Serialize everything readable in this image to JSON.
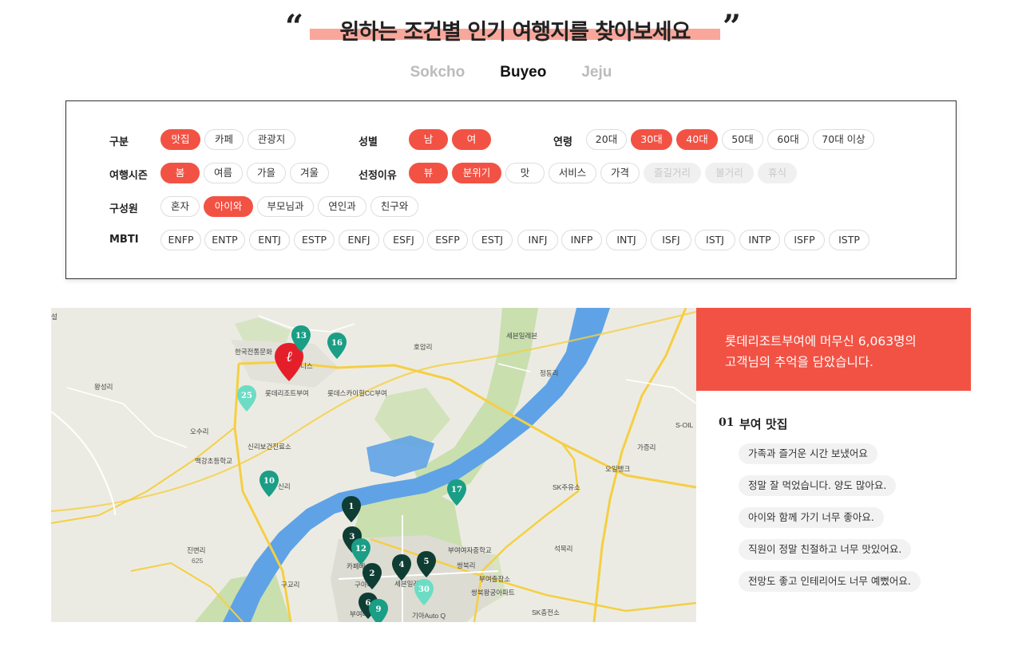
{
  "headline": {
    "quote_open": "“",
    "quote_close": "”",
    "text": "원하는 조건별 인기 여행지를 찾아보세요"
  },
  "regions": [
    {
      "label": "Sokcho",
      "active": false
    },
    {
      "label": "Buyeo",
      "active": true
    },
    {
      "label": "Jeju",
      "active": false
    }
  ],
  "filters": {
    "category": {
      "label": "구분",
      "options": [
        {
          "text": "맛집",
          "state": "selected"
        },
        {
          "text": "카페",
          "state": "normal"
        },
        {
          "text": "관광지",
          "state": "normal"
        }
      ]
    },
    "gender": {
      "label": "성별",
      "options": [
        {
          "text": "남",
          "state": "selected"
        },
        {
          "text": "여",
          "state": "selected"
        }
      ]
    },
    "age": {
      "label": "연령",
      "options": [
        {
          "text": "20대",
          "state": "normal"
        },
        {
          "text": "30대",
          "state": "selected"
        },
        {
          "text": "40대",
          "state": "selected"
        },
        {
          "text": "50대",
          "state": "normal"
        },
        {
          "text": "60대",
          "state": "normal"
        },
        {
          "text": "70대 이상",
          "state": "normal"
        }
      ]
    },
    "season": {
      "label": "여행시즌",
      "options": [
        {
          "text": "봄",
          "state": "selected"
        },
        {
          "text": "여름",
          "state": "normal"
        },
        {
          "text": "가을",
          "state": "normal"
        },
        {
          "text": "겨울",
          "state": "normal"
        }
      ]
    },
    "reason": {
      "label": "선정이유",
      "options": [
        {
          "text": "뷰",
          "state": "selected"
        },
        {
          "text": "분위기",
          "state": "selected"
        },
        {
          "text": "맛",
          "state": "normal"
        },
        {
          "text": "서비스",
          "state": "normal"
        },
        {
          "text": "가격",
          "state": "normal"
        },
        {
          "text": "즐길거리",
          "state": "disabled"
        },
        {
          "text": "볼거리",
          "state": "disabled"
        },
        {
          "text": "휴식",
          "state": "disabled"
        }
      ]
    },
    "companion": {
      "label": "구성원",
      "options": [
        {
          "text": "혼자",
          "state": "normal"
        },
        {
          "text": "아이와",
          "state": "selected"
        },
        {
          "text": "부모님과",
          "state": "normal"
        },
        {
          "text": "연인과",
          "state": "normal"
        },
        {
          "text": "친구와",
          "state": "normal"
        }
      ]
    },
    "mbti": {
      "label": "MBTI",
      "options": [
        {
          "text": "ENFP",
          "state": "normal"
        },
        {
          "text": "ENTP",
          "state": "normal"
        },
        {
          "text": "ENTJ",
          "state": "normal"
        },
        {
          "text": "ESTP",
          "state": "normal"
        },
        {
          "text": "ENFJ",
          "state": "normal"
        },
        {
          "text": "ESFJ",
          "state": "normal"
        },
        {
          "text": "ESFP",
          "state": "normal"
        },
        {
          "text": "ESTJ",
          "state": "normal"
        },
        {
          "text": "INFJ",
          "state": "normal"
        },
        {
          "text": "INFP",
          "state": "normal"
        },
        {
          "text": "INTJ",
          "state": "normal"
        },
        {
          "text": "ISFJ",
          "state": "normal"
        },
        {
          "text": "ISTJ",
          "state": "normal"
        },
        {
          "text": "INTP",
          "state": "normal"
        },
        {
          "text": "ISFP",
          "state": "normal"
        },
        {
          "text": "ISTP",
          "state": "normal"
        }
      ]
    }
  },
  "map": {
    "labels": [
      "한국전통문화",
      "니스",
      "롯데리조트부여",
      "롯데스카이힐CC부여",
      "호암리",
      "세븐일레븐",
      "정동리",
      "왕성리",
      "오수리",
      "신리보건진료소",
      "백강초등학교",
      "신리",
      "S-OIL",
      "가증리",
      "오일뱅크",
      "SK주유소",
      "진변리",
      "625",
      "구교리",
      "카페베",
      "구아리",
      "세븐일레븐",
      "부여여자중학교",
      "쌍북리",
      "부여출장소",
      "쌍북왕궁아파트",
      "석목리",
      "부여버",
      "기아Auto Q",
      "SK충전소",
      "설"
    ],
    "markers": [
      {
        "num": "13",
        "type": "teal"
      },
      {
        "num": "16",
        "type": "teal"
      },
      {
        "num": "25",
        "type": "light"
      },
      {
        "num": "10",
        "type": "teal"
      },
      {
        "num": "17",
        "type": "teal"
      },
      {
        "num": "1",
        "type": "dark"
      },
      {
        "num": "3",
        "type": "dark"
      },
      {
        "num": "12",
        "type": "teal"
      },
      {
        "num": "2",
        "type": "dark"
      },
      {
        "num": "4",
        "type": "dark"
      },
      {
        "num": "5",
        "type": "dark"
      },
      {
        "num": "30",
        "type": "light"
      },
      {
        "num": "6",
        "type": "dark"
      },
      {
        "num": "9",
        "type": "teal"
      }
    ],
    "colors": {
      "dark": "#0f3d33",
      "teal": "#1a9e86",
      "light": "#6ddcc4",
      "lotte": "#e51f2a",
      "river": "#5fa3e6",
      "green": "#c9dfae",
      "road": "#f5cf43"
    }
  },
  "review": {
    "line1": "롯데리조트부여에 머무신 6,063명의",
    "line2": "고객님의 추억을 담았습니다.",
    "section_number": "01",
    "section_title": "부여 맛집",
    "items": [
      "가족과 즐거운 시간 보냈어요",
      "정말 잘 먹었습니다. 양도 많아요.",
      "아이와 함께 가기 너무 좋아요.",
      "직원이 정말 친절하고 너무 맛있어요.",
      "전망도 좋고 인테리어도 너무 예뻤어요."
    ]
  }
}
